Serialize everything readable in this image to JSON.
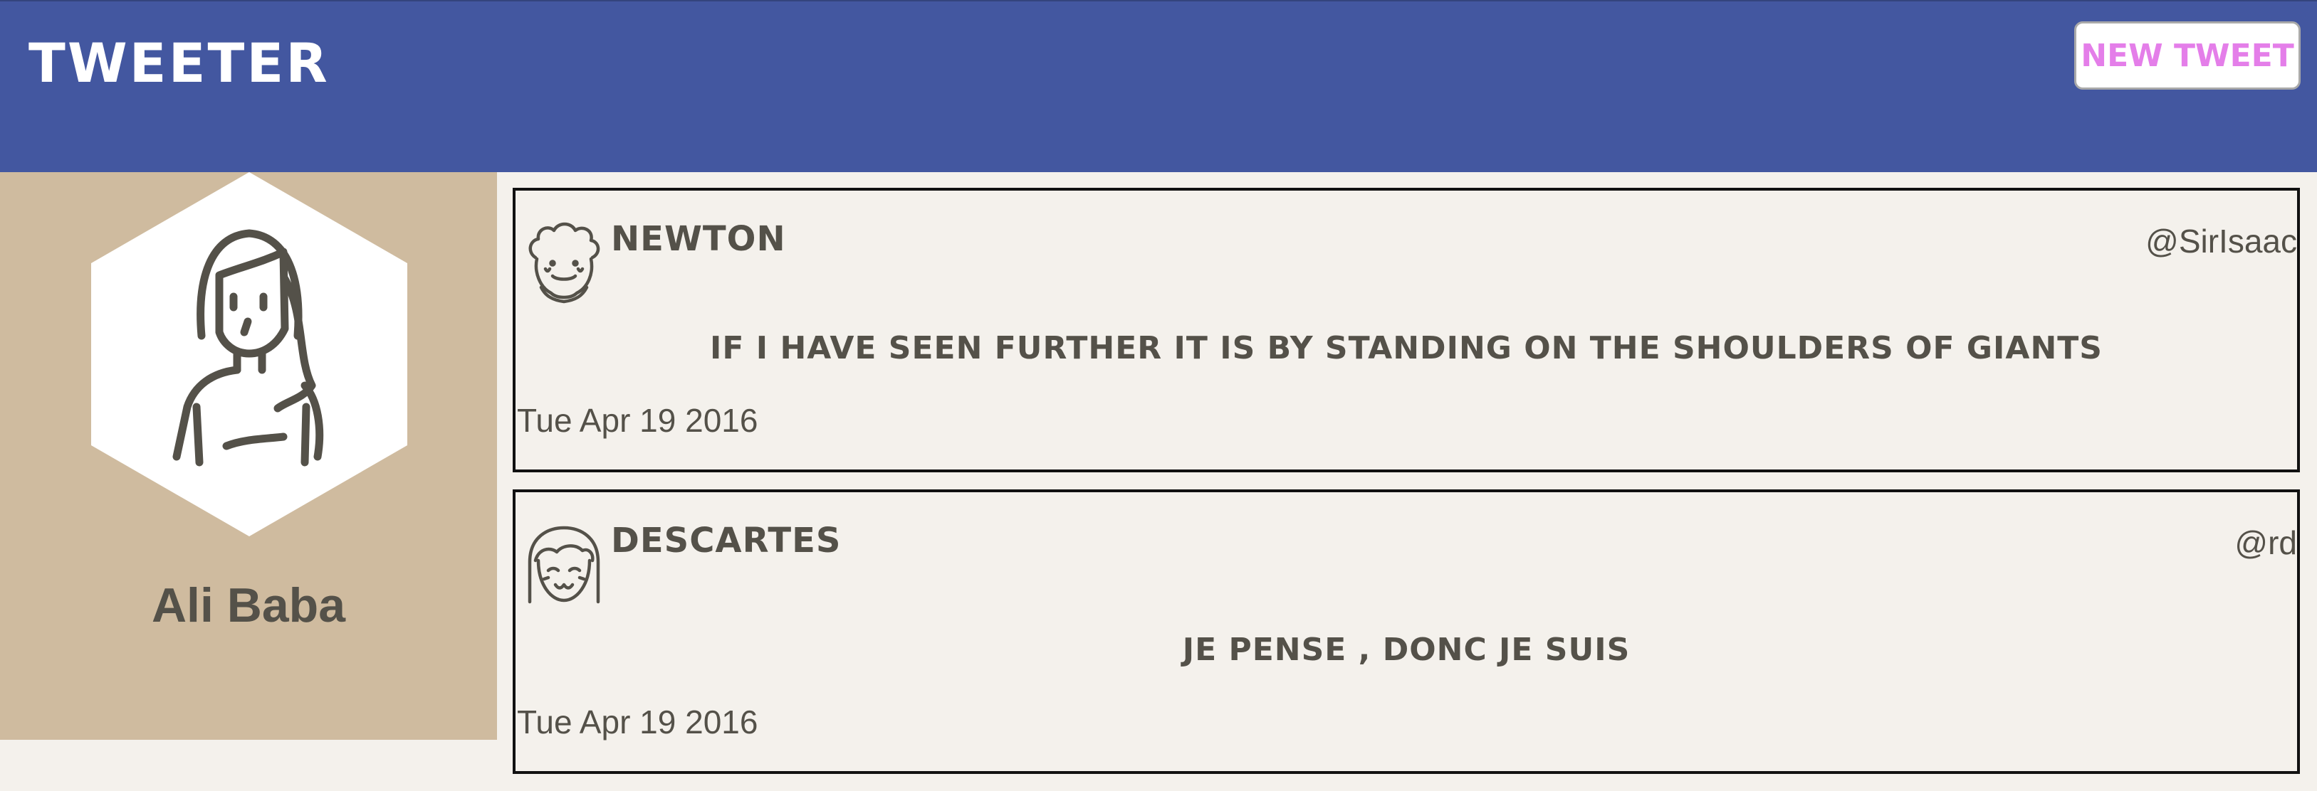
{
  "nav": {
    "brand": "TWEETER",
    "new_tweet_label": "NEW TWEET"
  },
  "profile": {
    "name": "Ali Baba",
    "avatar_icon": "woman-avatar-icon"
  },
  "tweets": [
    {
      "author": "NEWTON",
      "handle": "@SirIsaac",
      "content": "IF I HAVE SEEN FURTHER IT IS BY STANDING ON THE SHOULDERS OF GIANTS",
      "date": "Tue Apr 19 2016",
      "avatar_icon": "curly-hair-man-icon"
    },
    {
      "author": "DESCARTES",
      "handle": "@rd",
      "content": "JE PENSE , DONC JE SUIS",
      "date": "Tue Apr 19 2016",
      "avatar_icon": "bob-hair-woman-icon"
    }
  ],
  "colors": {
    "nav_bg": "#4357a0",
    "profile_bg": "#cfbb9f",
    "page_bg": "#f4f1ec",
    "accent_pink": "#e47ee9",
    "text": "#545149"
  }
}
